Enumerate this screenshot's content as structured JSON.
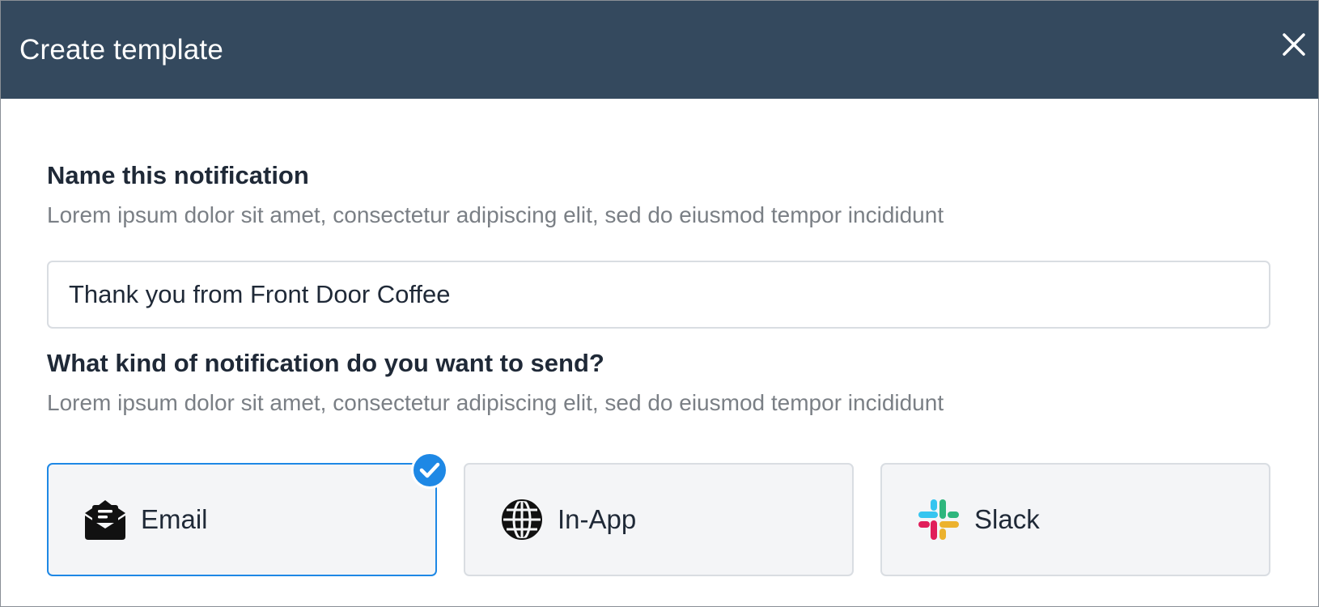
{
  "modal": {
    "title": "Create template"
  },
  "name_section": {
    "title": "Name this notification",
    "description": "Lorem ipsum dolor sit amet, consectetur adipiscing elit, sed do eiusmod tempor incididunt",
    "input_value": "Thank you from Front Door Coffee"
  },
  "kind_section": {
    "title": "What kind of notification do you want to send?",
    "description": "Lorem ipsum dolor sit amet, consectetur adipiscing elit, sed do eiusmod tempor incididunt",
    "options": [
      {
        "label": "Email",
        "icon": "open-envelope-icon",
        "selected": true
      },
      {
        "label": "In-App",
        "icon": "globe-icon",
        "selected": false
      },
      {
        "label": "Slack",
        "icon": "slack-icon",
        "selected": false
      }
    ]
  },
  "colors": {
    "header_bg": "#34495e",
    "accent": "#1e88e5",
    "card_bg": "#f4f5f7"
  }
}
